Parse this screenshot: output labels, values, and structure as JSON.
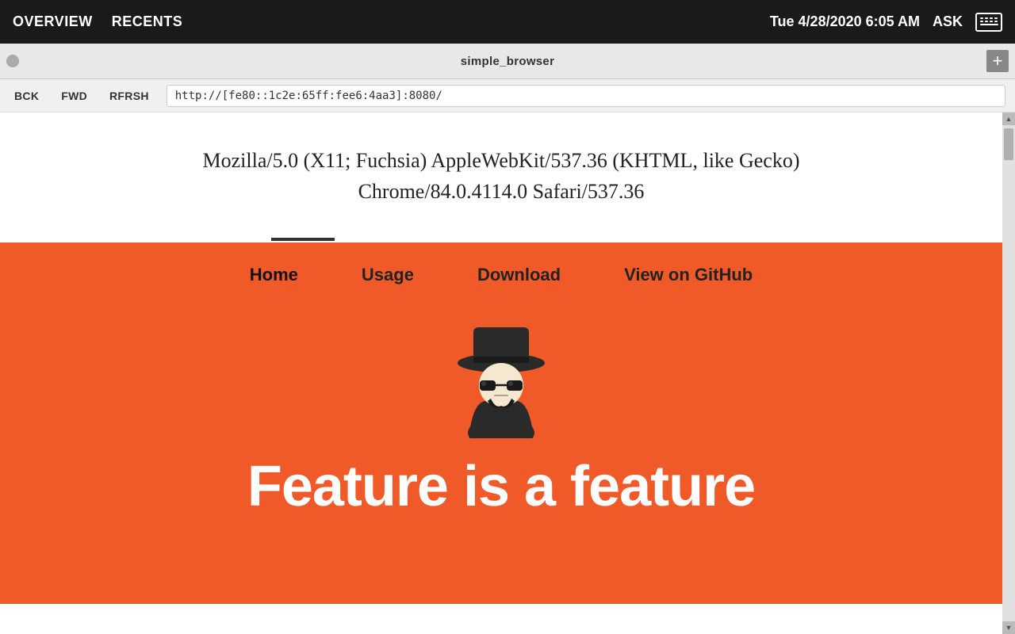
{
  "topbar": {
    "nav_items": [
      "OVERVIEW",
      "RECENTS"
    ],
    "datetime": "Tue 4/28/2020 6:05 AM",
    "ask_label": "ASK"
  },
  "browser_chrome": {
    "title": "simple_browser",
    "plus_label": "+"
  },
  "nav_bar": {
    "back_label": "BCK",
    "fwd_label": "FWD",
    "refresh_label": "RFRSH",
    "url": "http://[fe80::1c2e:65ff:fee6:4aa3]:8080/"
  },
  "page": {
    "user_agent": "Mozilla/5.0 (X11; Fuchsia) AppleWebKit/537.36 (KHTML, like Gecko)\nChrome/84.0.4114.0 Safari/537.36",
    "nav_items": [
      {
        "label": "Home",
        "active": true
      },
      {
        "label": "Usage",
        "active": false
      },
      {
        "label": "Download",
        "active": false
      },
      {
        "label": "View on GitHub",
        "active": false
      }
    ],
    "feature_text": "Feature is a feature"
  }
}
